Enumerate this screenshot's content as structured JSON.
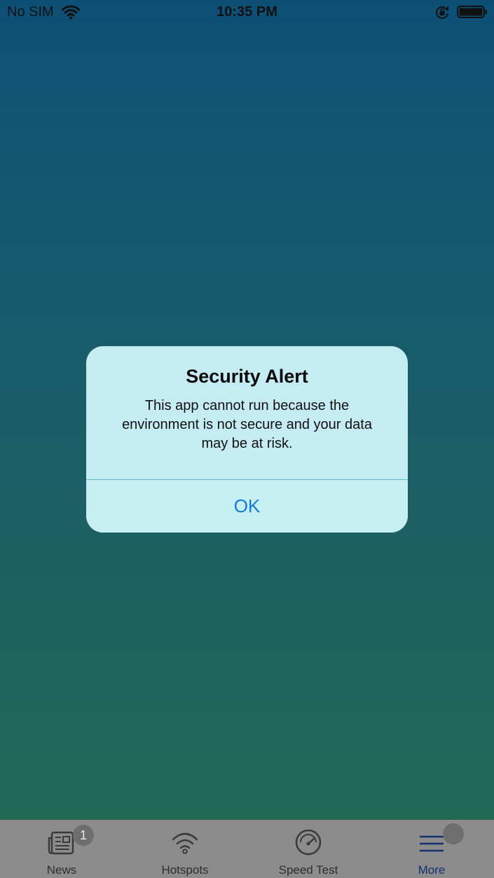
{
  "status_bar": {
    "carrier": "No SIM",
    "time": "10:35 PM"
  },
  "alert": {
    "title": "Security Alert",
    "message": "This app cannot run because the environment is not secure and your data may be at risk.",
    "ok_label": "OK"
  },
  "tab_bar": {
    "items": [
      {
        "label": "News",
        "icon": "newspaper-icon",
        "badge": "1"
      },
      {
        "label": "Hotspots",
        "icon": "wifi-icon"
      },
      {
        "label": "Speed Test",
        "icon": "speedometer-icon"
      },
      {
        "label": "More",
        "icon": "menu-icon",
        "active": true
      }
    ]
  },
  "colors": {
    "background_top": "#0e4f76",
    "background_bottom": "#236b52",
    "alert_background": "#c6ecf3",
    "alert_button_text": "#1479e0",
    "tab_bar_background": "#8c8c8c",
    "active_tab": "#15306e"
  }
}
